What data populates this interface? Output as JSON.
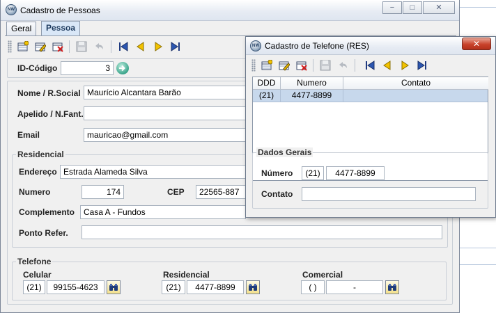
{
  "main_window": {
    "title": "Cadastro de Pessoas",
    "app_icon": "NW",
    "controls": {
      "minimize": "−",
      "maximize": "□",
      "close": "✕"
    },
    "tabs": [
      {
        "label": "Geral",
        "active": false
      },
      {
        "label": "Pessoa",
        "active": true
      }
    ],
    "toolbar_icons": [
      "new-record-icon",
      "edit-record-icon",
      "delete-record-icon",
      "save-icon",
      "undo-icon",
      "first-record-icon",
      "previous-record-icon",
      "next-record-icon",
      "last-record-icon"
    ],
    "id_label": "ID-Código",
    "id_value": "3",
    "fields": {
      "nome_label": "Nome / R.Social",
      "nome_value": "Maurício Alcantara Barão",
      "apelido_label": "Apelido / N.Fant.",
      "apelido_value": "",
      "email_label": "Email",
      "email_value": "mauricao@gmail.com"
    },
    "residencial": {
      "legend": "Residencial",
      "endereco_label": "Endereço",
      "endereco_value": "Estrada Alameda Silva",
      "numero_label": "Numero",
      "numero_value": "174",
      "cep_label": "CEP",
      "cep_value": "22565-887",
      "complemento_label": "Complemento",
      "complemento_value": "Casa A - Fundos",
      "ponto_label": "Ponto Refer.",
      "ponto_value": ""
    },
    "telefone": {
      "legend": "Telefone",
      "celular_label": "Celular",
      "celular_ddd": "(21)",
      "celular_numero": "99155-4623",
      "residencial_label": "Residencial",
      "residencial_ddd": "(21)",
      "residencial_numero": "4477-8899",
      "comercial_label": "Comercial",
      "comercial_ddd": "(  )",
      "comercial_numero": "-"
    }
  },
  "phone_window": {
    "title": "Cadastro de Telefone (RES)",
    "app_icon": "NW",
    "close": "✕",
    "grid": {
      "columns": [
        "DDD",
        "Numero",
        "Contato"
      ],
      "rows": [
        {
          "ddd": "(21)",
          "numero": "4477-8899",
          "contato": ""
        }
      ]
    },
    "dados_gerais": {
      "legend": "Dados Gerais",
      "numero_label": "Número",
      "ddd_value": "(21)",
      "numero_value": "4477-8899",
      "contato_label": "Contato",
      "contato_value": ""
    }
  },
  "colors": {
    "grid_selected_row": "#c7d8ec",
    "active_tab": "#d9e7f7",
    "close_button": "#c8422b",
    "search_button": "#f3e08a"
  }
}
